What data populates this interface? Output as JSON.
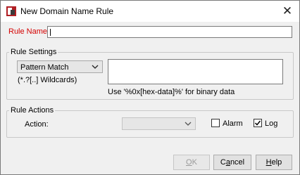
{
  "window": {
    "title": "New Domain Name Rule",
    "close": "✕"
  },
  "rule_name": {
    "label": "Rule Name:",
    "value": ""
  },
  "rule_settings": {
    "legend": "Rule Settings",
    "match_type": "Pattern Match",
    "wildcards_hint": "(*.?[..] Wildcards)",
    "pattern_value": "",
    "binary_hint": "Use '%0x[hex-data]%' for binary data"
  },
  "rule_actions": {
    "legend": "Rule Actions",
    "action_label": "Action:",
    "action_value": "",
    "alarm_label": "Alarm",
    "alarm_checked": false,
    "log_label": "Log",
    "log_checked": true
  },
  "buttons": {
    "ok_u": "O",
    "ok_rest": "K",
    "cancel_pre": "C",
    "cancel_u": "a",
    "cancel_rest": "ncel",
    "help_u": "H",
    "help_rest": "elp"
  },
  "colors": {
    "required_label": "#d40000",
    "dialog_bg": "#f0f0f0"
  }
}
